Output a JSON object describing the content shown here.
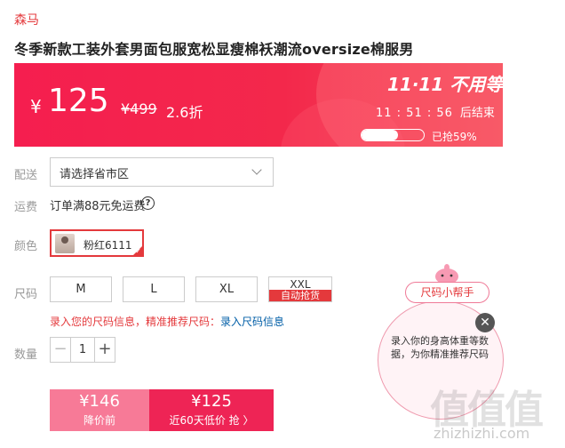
{
  "brand": "森马",
  "product_title": "冬季新款工装外套男面包服宽松显瘦棉袄潮流oversize棉服男",
  "banner": {
    "currency": "¥",
    "price": "125",
    "original_price": "¥499",
    "discount": "2.6折",
    "event_label": "11·11 不用等",
    "countdown": "11 : 51 : 56",
    "countdown_suffix": "后结束",
    "progress_text": "已抢59%",
    "progress_fraction": 0.59
  },
  "delivery": {
    "label": "配送",
    "placeholder": "请选择省市区"
  },
  "shipping": {
    "label": "运费",
    "text": "订单满88元免运费",
    "help_glyph": "?"
  },
  "color": {
    "label": "颜色",
    "selected": "粉红6111"
  },
  "size": {
    "label": "尺码",
    "options": [
      "M",
      "L",
      "XL",
      "XXL"
    ],
    "xxl_tag": "自动抢货",
    "tip_text": "录入您的尺码信息，精准推荐尺码：",
    "tip_link": "录入尺码信息"
  },
  "quantity": {
    "label": "数量",
    "value": "1",
    "minus": "−",
    "plus": "+"
  },
  "buy": {
    "left_price": "¥146",
    "left_sub": "降价前",
    "right_price": "¥125",
    "right_sub": "近60天低价 抢 〉"
  },
  "size_helper": {
    "title": "尺码小帮手",
    "text": "录入你的身高体重等数据，为你精准推荐尺码",
    "close": "✕"
  },
  "watermark": {
    "logo": "值值值",
    "url": "zhizhizhi.com"
  },
  "colors": {
    "accent": "#e4393c",
    "banner": "#f51e4f",
    "buy_light": "#f77a97",
    "buy_dark": "#ee2455"
  }
}
